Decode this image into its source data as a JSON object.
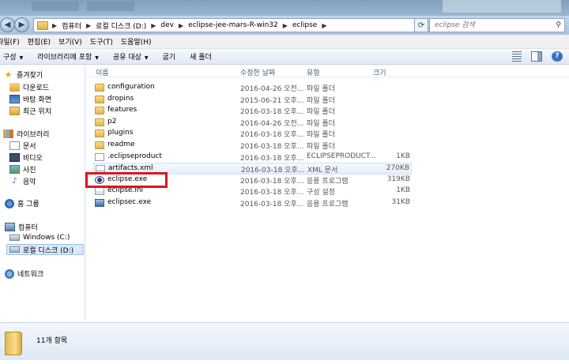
{
  "address": {
    "crumbs": [
      "컴퓨터",
      "로컬 디스크 (D:)",
      "dev",
      "eclipse-jee-mars-R-win32",
      "eclipse"
    ]
  },
  "search": {
    "placeholder": "eclipse 검색"
  },
  "menu": [
    "파일(F)",
    "편집(E)",
    "보기(V)",
    "도구(T)",
    "도움말(H)"
  ],
  "toolbar": {
    "organize": "구성",
    "include_library": "라이브러리에 포함",
    "share": "공유 대상",
    "burn": "굽기",
    "new_folder": "새 폴더"
  },
  "nav": {
    "favorites": "즐겨찾기",
    "downloads": "다운로드",
    "desktop": "바탕 화면",
    "recent": "최근 위치",
    "libraries": "라이브러리",
    "documents": "문서",
    "videos": "비디오",
    "pictures": "사진",
    "music": "음악",
    "homegroup": "홈 그룹",
    "computer": "컴퓨터",
    "drive_c": "Windows (C:)",
    "drive_d": "로컬 디스크 (D:)",
    "network": "네트워크"
  },
  "columns": {
    "name": "이름",
    "date": "수정한 날짜",
    "type": "유형",
    "size": "크기"
  },
  "files": [
    {
      "name": "configuration",
      "date": "2016-04-26 오전...",
      "type": "파일 폴더",
      "size": "",
      "icon": "folder-icon"
    },
    {
      "name": "dropins",
      "date": "2015-06-21 오후...",
      "type": "파일 폴더",
      "size": "",
      "icon": "folder-icon"
    },
    {
      "name": "features",
      "date": "2016-03-18 오후...",
      "type": "파일 폴더",
      "size": "",
      "icon": "folder-icon"
    },
    {
      "name": "p2",
      "date": "2016-04-26 오전...",
      "type": "파일 폴더",
      "size": "",
      "icon": "folder-icon"
    },
    {
      "name": "plugins",
      "date": "2016-03-18 오후...",
      "type": "파일 폴더",
      "size": "",
      "icon": "folder-icon"
    },
    {
      "name": "readme",
      "date": "2016-03-18 오후...",
      "type": "파일 폴더",
      "size": "",
      "icon": "folder-icon"
    },
    {
      "name": ".eclipseproduct",
      "date": "2016-03-18 오후...",
      "type": "ECLIPSEPRODUCT...",
      "size": "1KB",
      "icon": "file-icon"
    },
    {
      "name": "artifacts.xml",
      "date": "2016-03-18 오후...",
      "type": "XML 문서",
      "size": "270KB",
      "icon": "xml-file-icon"
    },
    {
      "name": "eclipse.exe",
      "date": "2016-03-18 오후...",
      "type": "응용 프로그램",
      "size": "319KB",
      "icon": "eclipse-icon"
    },
    {
      "name": "eclipse.ini",
      "date": "2016-03-18 오후...",
      "type": "구성 설정",
      "size": "1KB",
      "icon": "ini-file-icon"
    },
    {
      "name": "eclipsec.exe",
      "date": "2016-03-18 오후...",
      "type": "응용 프로그램",
      "size": "31KB",
      "icon": "exe-file-icon"
    }
  ],
  "status": {
    "count": "11개 항목"
  },
  "colors": {
    "highlight": "#e0141e",
    "toolbar": "#dfe9f5",
    "selection": "#dbe8f7"
  }
}
